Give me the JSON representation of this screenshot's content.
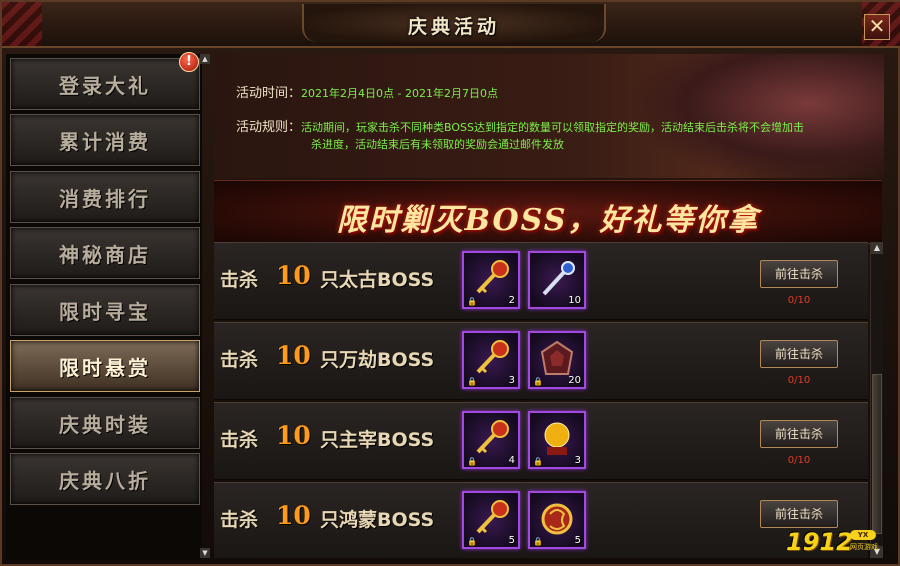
{
  "window": {
    "title": "庆典活动",
    "close_label": "✕"
  },
  "sidebar": {
    "items": [
      {
        "label": "登录大礼"
      },
      {
        "label": "累计消费"
      },
      {
        "label": "消费排行"
      },
      {
        "label": "神秘商店"
      },
      {
        "label": "限时寻宝"
      },
      {
        "label": "限时悬赏",
        "active": true
      },
      {
        "label": "庆典时装"
      },
      {
        "label": "庆典八折"
      }
    ],
    "alert_symbol": "!"
  },
  "info": {
    "time_label": "活动时间：",
    "time_value": "2021年2月4日0点 - 2021年2月7日0点",
    "rule_label": "活动规则：",
    "rule_line1": "活动期间，玩家击杀不同种类BOSS达到指定的数量可以领取指定的奖励，活动结束后击杀将不会增加击",
    "rule_line2": "杀进度，活动结束后有未领取的奖励会通过邮件发放"
  },
  "banner": {
    "text": "限时剿灭BOSS，好礼等你拿"
  },
  "rows": [
    {
      "kill": "击杀",
      "count": "10",
      "boss": "只太古BOSS",
      "rewards": [
        {
          "icon": "red-key-icon",
          "count": "2"
        },
        {
          "icon": "silver-scepter-icon",
          "count": "10"
        }
      ],
      "button": "前往击杀",
      "progress": "0/10"
    },
    {
      "kill": "击杀",
      "count": "10",
      "boss": "只万劫BOSS",
      "rewards": [
        {
          "icon": "red-key-icon",
          "count": "3"
        },
        {
          "icon": "rune-stone-icon",
          "count": "20"
        }
      ],
      "button": "前往击杀",
      "progress": "0/10"
    },
    {
      "kill": "击杀",
      "count": "10",
      "boss": "只主宰BOSS",
      "rewards": [
        {
          "icon": "red-key-icon",
          "count": "4"
        },
        {
          "icon": "golden-orb-icon",
          "count": "3"
        }
      ],
      "button": "前往击杀",
      "progress": "0/10"
    },
    {
      "kill": "击杀",
      "count": "10",
      "boss": "只鸿蒙BOSS",
      "rewards": [
        {
          "icon": "red-key-icon",
          "count": "5"
        },
        {
          "icon": "dragon-emblem-icon",
          "count": "5"
        }
      ],
      "button": "前往击杀",
      "progress": ""
    }
  ],
  "watermark": {
    "text": "1912",
    "badge": "YX",
    "sub": "网页游戏"
  },
  "colors": {
    "accent_orange": "#ff9a1a",
    "progress_red": "#e23a2a",
    "rule_green": "#7cf04a",
    "slot_purple": "#a24ae0"
  }
}
